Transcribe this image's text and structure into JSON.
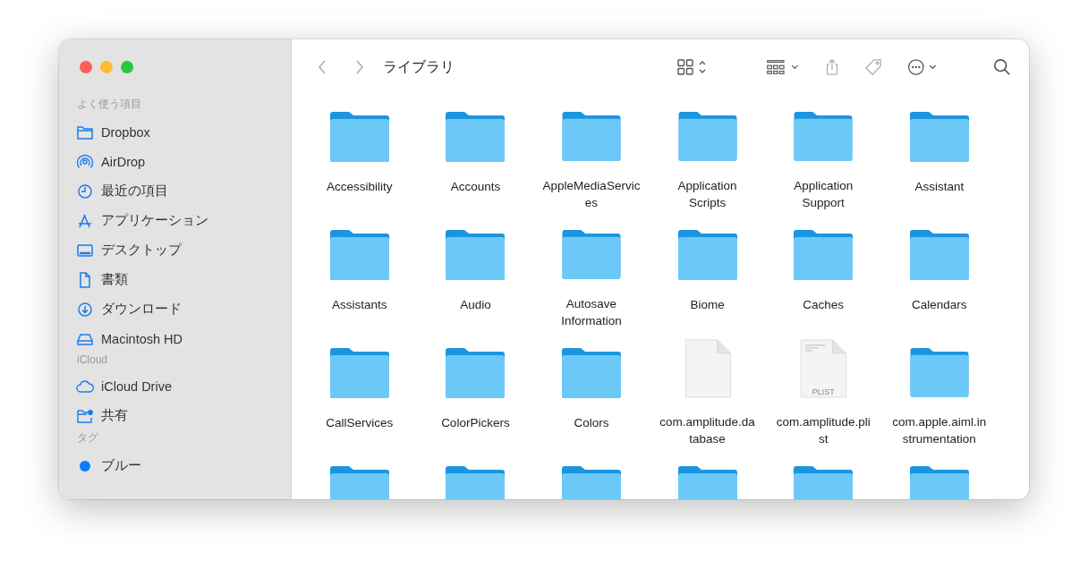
{
  "window": {
    "title": "ライブラリ"
  },
  "sidebar": {
    "sections": [
      {
        "title": "よく使う項目",
        "items": [
          {
            "label": "Dropbox"
          },
          {
            "label": "AirDrop"
          },
          {
            "label": "最近の項目"
          },
          {
            "label": "アプリケーション"
          },
          {
            "label": "デスクトップ"
          },
          {
            "label": "書類"
          },
          {
            "label": "ダウンロード"
          },
          {
            "label": "Macintosh HD"
          }
        ]
      },
      {
        "title": "iCloud",
        "items": [
          {
            "label": "iCloud Drive"
          },
          {
            "label": "共有"
          }
        ]
      },
      {
        "title": "タグ",
        "items": [
          {
            "label": "ブルー",
            "color": "#0a7aff"
          }
        ]
      }
    ]
  },
  "items": [
    {
      "kind": "folder",
      "name": [
        "Accessibility"
      ]
    },
    {
      "kind": "folder",
      "name": [
        "Accounts"
      ]
    },
    {
      "kind": "folder",
      "name": [
        "AppleMediaServic",
        "es"
      ]
    },
    {
      "kind": "folder",
      "name": [
        "Application",
        "Scripts"
      ]
    },
    {
      "kind": "folder",
      "name": [
        "Application",
        "Support"
      ]
    },
    {
      "kind": "folder",
      "name": [
        "Assistant"
      ]
    },
    {
      "kind": "folder",
      "name": [
        "Assistants"
      ]
    },
    {
      "kind": "folder",
      "name": [
        "Audio"
      ]
    },
    {
      "kind": "folder",
      "name": [
        "Autosave",
        "Information"
      ]
    },
    {
      "kind": "folder",
      "name": [
        "Biome"
      ]
    },
    {
      "kind": "folder",
      "name": [
        "Caches"
      ]
    },
    {
      "kind": "folder",
      "name": [
        "Calendars"
      ]
    },
    {
      "kind": "folder",
      "name": [
        "CallServices"
      ]
    },
    {
      "kind": "folder",
      "name": [
        "ColorPickers"
      ]
    },
    {
      "kind": "folder",
      "name": [
        "Colors"
      ]
    },
    {
      "kind": "file",
      "name": [
        "com.amplitude.da",
        "tabase"
      ]
    },
    {
      "kind": "plist",
      "badge": "PLIST",
      "name": [
        "com.amplitude.pli",
        "st"
      ]
    },
    {
      "kind": "folder",
      "name": [
        "com.apple.aiml.in",
        "strumentation"
      ]
    },
    {
      "kind": "folder"
    },
    {
      "kind": "folder"
    },
    {
      "kind": "folder"
    },
    {
      "kind": "folder"
    },
    {
      "kind": "folder"
    },
    {
      "kind": "folder"
    }
  ]
}
